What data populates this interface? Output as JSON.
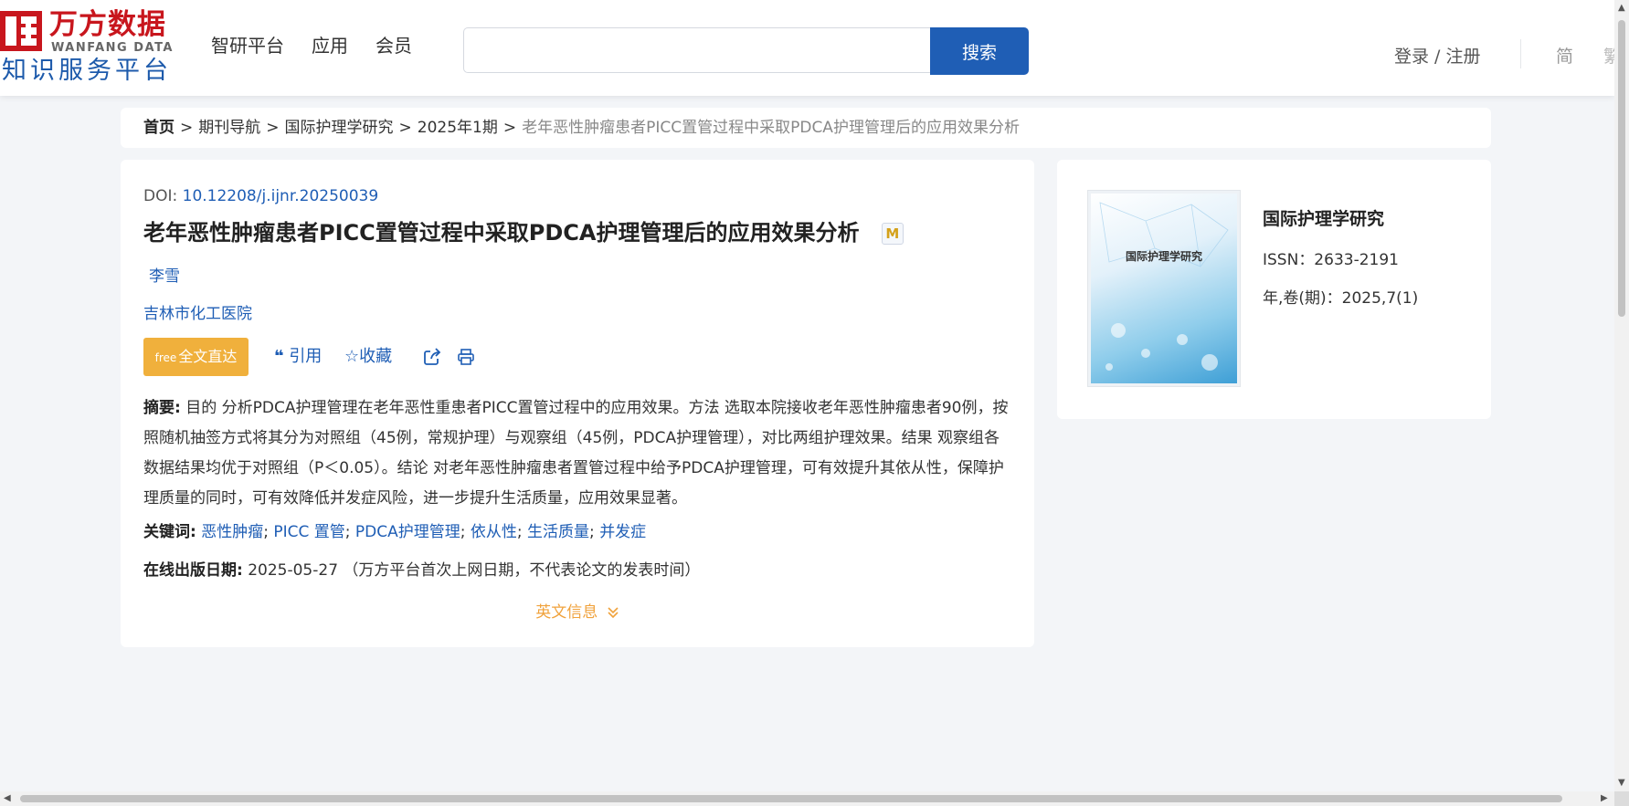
{
  "header": {
    "logo_cn": "万方数据",
    "logo_en": "WANFANG DATA",
    "logo_sub": "知识服务平台",
    "nav": [
      "智研平台",
      "应用",
      "会员"
    ],
    "search_value": "",
    "search_button": "搜索",
    "login": "登录 / 注册",
    "lang_simplified": "简",
    "lang_traditional": "繁"
  },
  "breadcrumb": {
    "home": "首页",
    "items": [
      "期刊导航",
      "国际护理学研究",
      "2025年1期"
    ],
    "separator": ">",
    "current": "老年恶性肿瘤患者PICC置管过程中采取PDCA护理管理后的应用效果分析"
  },
  "article": {
    "doi_label": "DOI:",
    "doi": "10.12208/j.ijnr.20250039",
    "title": "老年恶性肿瘤患者PICC置管过程中采取PDCA护理管理后的应用效果分析",
    "badge": "M",
    "author": "李雪",
    "org": "吉林市化工医院",
    "fulltext_label": "全文直达",
    "fulltext_icon": "free",
    "cite_label": "引用",
    "favorite_label": "收藏",
    "abstract_label": "摘要:",
    "abstract": "目的 分析PDCA护理管理在老年恶性重患者PICC置管过程中的应用效果。方法 选取本院接收老年恶性肿瘤患者90例，按照随机抽签方式将其分为对照组（45例，常规护理）与观察组（45例，PDCA护理管理），对比两组护理效果。结果 观察组各数据结果均优于对照组（P＜0.05）。结论 对老年恶性肿瘤患者置管过程中给予PDCA护理管理，可有效提升其依从性，保障护理质量的同时，可有效降低并发症风险，进一步提升生活质量，应用效果显著。",
    "keywords_label": "关键词:",
    "keywords": [
      "恶性肿瘤",
      "PICC 置管",
      "PDCA护理管理",
      "依从性",
      "生活质量",
      "并发症"
    ],
    "date_label": "在线出版日期:",
    "date": "2025-05-27",
    "date_note": "（万方平台首次上网日期，不代表论文的发表时间）",
    "english_info": "英文信息"
  },
  "journal": {
    "cover_title": "国际护理学研究",
    "title": "国际护理学研究",
    "issn": "ISSN：2633-2191",
    "volume": "年,卷(期)：2025,7(1)"
  },
  "colors": {
    "brand_red": "#c8161d",
    "link_blue": "#1f5eb5",
    "accent_orange": "#f0b03c"
  }
}
